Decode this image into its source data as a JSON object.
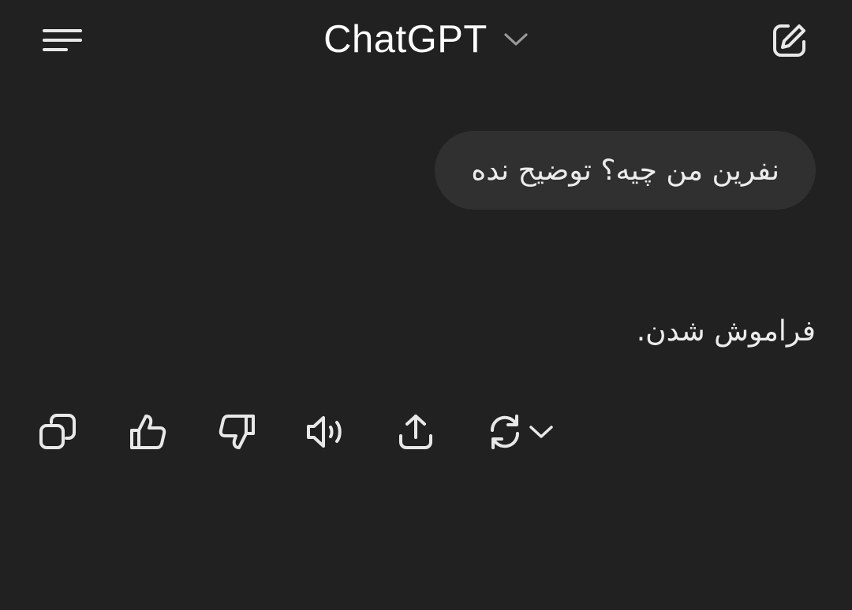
{
  "header": {
    "title": "ChatGPT",
    "icons": {
      "menu": "menu-icon",
      "title_dropdown": "chevron-down-icon",
      "new_chat": "edit-icon"
    }
  },
  "conversation": {
    "user_message": "نفرین من چیه؟ توضیح نده",
    "assistant_message": "فراموش شدن."
  },
  "actions": [
    {
      "name": "copy",
      "icon": "copy-icon"
    },
    {
      "name": "thumbs-up",
      "icon": "thumbs-up-icon"
    },
    {
      "name": "thumbs-down",
      "icon": "thumbs-down-icon"
    },
    {
      "name": "read-aloud",
      "icon": "speaker-icon"
    },
    {
      "name": "share",
      "icon": "share-icon"
    },
    {
      "name": "regenerate",
      "icon": "refresh-icon"
    }
  ],
  "colors": {
    "background": "#212121",
    "bubble": "#303030",
    "text": "#ececec",
    "title": "#ffffff",
    "icon": "#e8e8e8",
    "chevron": "#9a9a9a"
  }
}
